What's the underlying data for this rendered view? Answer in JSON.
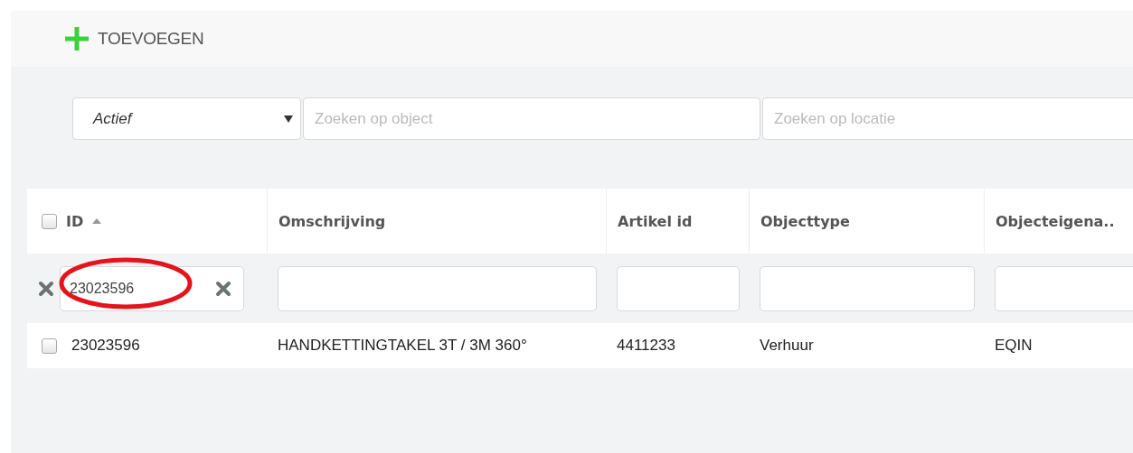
{
  "toolbar": {
    "add_button": "TOEVOEGEN"
  },
  "filters": {
    "status": {
      "value": "Actief"
    },
    "object_search": {
      "placeholder": "Zoeken op object"
    },
    "location_search": {
      "placeholder": "Zoeken op locatie"
    }
  },
  "table": {
    "select_all": {
      "checked": false
    },
    "columns": [
      {
        "label": "ID",
        "sorted": true,
        "filter_value": "23023596"
      },
      {
        "label": "Omschrijving",
        "sorted": false
      },
      {
        "label": "Artikel id",
        "sorted": false
      },
      {
        "label": "Objecttype",
        "sorted": false
      },
      {
        "label": "Objecteigena..",
        "sorted": false
      }
    ],
    "rows": [
      {
        "checked": false,
        "cells": [
          "23023596",
          "HANDKETTINGTAKEL 3T / 3M 360°",
          "4411233",
          "Verhuur",
          "EQIN"
        ]
      }
    ]
  }
}
